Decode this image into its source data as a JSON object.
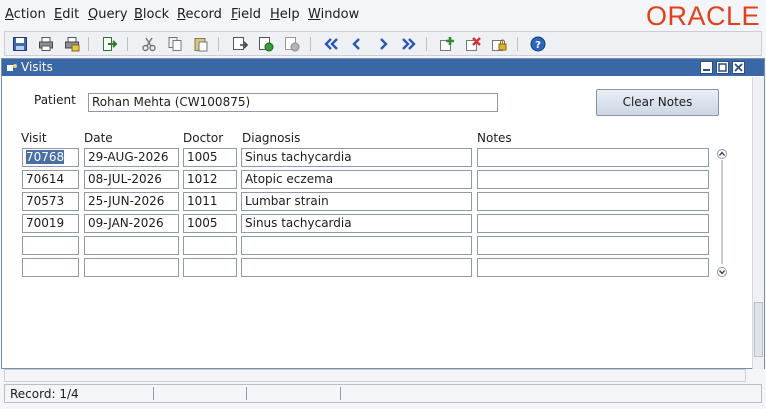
{
  "menu": {
    "items": [
      "Action",
      "Edit",
      "Query",
      "Block",
      "Record",
      "Field",
      "Help",
      "Window"
    ],
    "mnemonics": [
      "A",
      "E",
      "Q",
      "B",
      "R",
      "F",
      "H",
      "W"
    ],
    "rests": [
      "ction",
      "dit",
      "uery",
      "lock",
      "ecord",
      "ield",
      "elp",
      "indow"
    ],
    "brand": "ORACLE",
    "brand_color": "#e2401c"
  },
  "toolbar": {
    "icons": [
      "save-icon",
      "print-icon",
      "print-setup-icon",
      "exit-icon",
      "cut-icon",
      "copy-icon",
      "paste-icon",
      "enter-query-icon",
      "execute-query-icon",
      "cancel-query-icon",
      "first-record-icon",
      "previous-record-icon",
      "next-record-icon",
      "last-record-icon",
      "insert-record-icon",
      "delete-record-icon",
      "lock-record-icon",
      "help-icon"
    ]
  },
  "window": {
    "title": "Visits",
    "title_color": "#3a68a6"
  },
  "patient": {
    "label": "Patient",
    "value": "Rohan Mehta  (CW100875)"
  },
  "clear_notes_label": "Clear Notes",
  "table": {
    "headers": {
      "visit": "Visit",
      "date": "Date",
      "doctor": "Doctor",
      "diagnosis": "Diagnosis",
      "notes": "Notes"
    },
    "rows": [
      {
        "visit": "70768",
        "date": "29-AUG-2026",
        "doctor": "1005",
        "diagnosis": "Sinus tachycardia",
        "notes": ""
      },
      {
        "visit": "70614",
        "date": "08-JUL-2026",
        "doctor": "1012",
        "diagnosis": "Atopic eczema",
        "notes": ""
      },
      {
        "visit": "70573",
        "date": "25-JUN-2026",
        "doctor": "1011",
        "diagnosis": "Lumbar strain",
        "notes": ""
      },
      {
        "visit": "70019",
        "date": "09-JAN-2026",
        "doctor": "1005",
        "diagnosis": "Sinus tachycardia",
        "notes": ""
      },
      {
        "visit": "",
        "date": "",
        "doctor": "",
        "diagnosis": "",
        "notes": ""
      },
      {
        "visit": "",
        "date": "",
        "doctor": "",
        "diagnosis": "",
        "notes": ""
      }
    ]
  },
  "status": {
    "record": "Record: 1/4"
  }
}
